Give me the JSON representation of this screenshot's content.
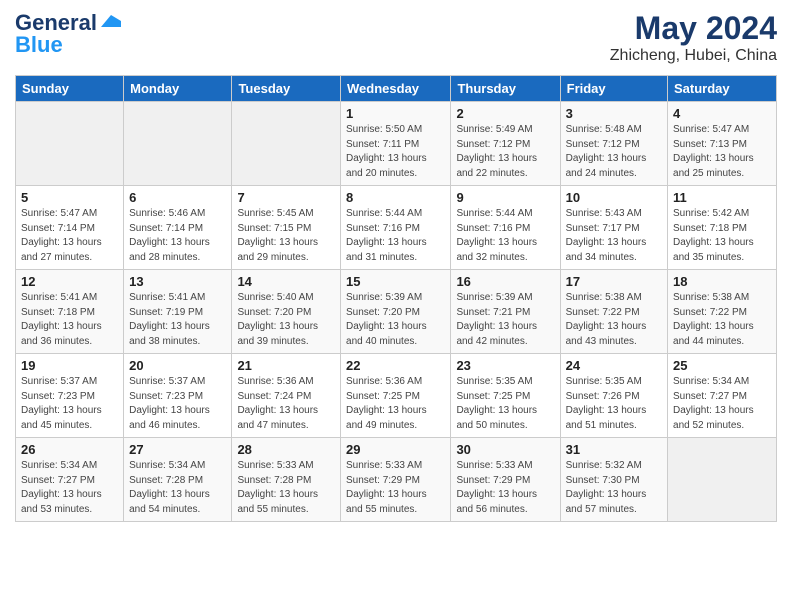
{
  "header": {
    "logo_general": "General",
    "logo_blue": "Blue",
    "month": "May 2024",
    "location": "Zhicheng, Hubei, China"
  },
  "weekdays": [
    "Sunday",
    "Monday",
    "Tuesday",
    "Wednesday",
    "Thursday",
    "Friday",
    "Saturday"
  ],
  "weeks": [
    [
      {
        "day": "",
        "sunrise": "",
        "sunset": "",
        "daylight": ""
      },
      {
        "day": "",
        "sunrise": "",
        "sunset": "",
        "daylight": ""
      },
      {
        "day": "",
        "sunrise": "",
        "sunset": "",
        "daylight": ""
      },
      {
        "day": "1",
        "sunrise": "Sunrise: 5:50 AM",
        "sunset": "Sunset: 7:11 PM",
        "daylight": "Daylight: 13 hours and 20 minutes."
      },
      {
        "day": "2",
        "sunrise": "Sunrise: 5:49 AM",
        "sunset": "Sunset: 7:12 PM",
        "daylight": "Daylight: 13 hours and 22 minutes."
      },
      {
        "day": "3",
        "sunrise": "Sunrise: 5:48 AM",
        "sunset": "Sunset: 7:12 PM",
        "daylight": "Daylight: 13 hours and 24 minutes."
      },
      {
        "day": "4",
        "sunrise": "Sunrise: 5:47 AM",
        "sunset": "Sunset: 7:13 PM",
        "daylight": "Daylight: 13 hours and 25 minutes."
      }
    ],
    [
      {
        "day": "5",
        "sunrise": "Sunrise: 5:47 AM",
        "sunset": "Sunset: 7:14 PM",
        "daylight": "Daylight: 13 hours and 27 minutes."
      },
      {
        "day": "6",
        "sunrise": "Sunrise: 5:46 AM",
        "sunset": "Sunset: 7:14 PM",
        "daylight": "Daylight: 13 hours and 28 minutes."
      },
      {
        "day": "7",
        "sunrise": "Sunrise: 5:45 AM",
        "sunset": "Sunset: 7:15 PM",
        "daylight": "Daylight: 13 hours and 29 minutes."
      },
      {
        "day": "8",
        "sunrise": "Sunrise: 5:44 AM",
        "sunset": "Sunset: 7:16 PM",
        "daylight": "Daylight: 13 hours and 31 minutes."
      },
      {
        "day": "9",
        "sunrise": "Sunrise: 5:44 AM",
        "sunset": "Sunset: 7:16 PM",
        "daylight": "Daylight: 13 hours and 32 minutes."
      },
      {
        "day": "10",
        "sunrise": "Sunrise: 5:43 AM",
        "sunset": "Sunset: 7:17 PM",
        "daylight": "Daylight: 13 hours and 34 minutes."
      },
      {
        "day": "11",
        "sunrise": "Sunrise: 5:42 AM",
        "sunset": "Sunset: 7:18 PM",
        "daylight": "Daylight: 13 hours and 35 minutes."
      }
    ],
    [
      {
        "day": "12",
        "sunrise": "Sunrise: 5:41 AM",
        "sunset": "Sunset: 7:18 PM",
        "daylight": "Daylight: 13 hours and 36 minutes."
      },
      {
        "day": "13",
        "sunrise": "Sunrise: 5:41 AM",
        "sunset": "Sunset: 7:19 PM",
        "daylight": "Daylight: 13 hours and 38 minutes."
      },
      {
        "day": "14",
        "sunrise": "Sunrise: 5:40 AM",
        "sunset": "Sunset: 7:20 PM",
        "daylight": "Daylight: 13 hours and 39 minutes."
      },
      {
        "day": "15",
        "sunrise": "Sunrise: 5:39 AM",
        "sunset": "Sunset: 7:20 PM",
        "daylight": "Daylight: 13 hours and 40 minutes."
      },
      {
        "day": "16",
        "sunrise": "Sunrise: 5:39 AM",
        "sunset": "Sunset: 7:21 PM",
        "daylight": "Daylight: 13 hours and 42 minutes."
      },
      {
        "day": "17",
        "sunrise": "Sunrise: 5:38 AM",
        "sunset": "Sunset: 7:22 PM",
        "daylight": "Daylight: 13 hours and 43 minutes."
      },
      {
        "day": "18",
        "sunrise": "Sunrise: 5:38 AM",
        "sunset": "Sunset: 7:22 PM",
        "daylight": "Daylight: 13 hours and 44 minutes."
      }
    ],
    [
      {
        "day": "19",
        "sunrise": "Sunrise: 5:37 AM",
        "sunset": "Sunset: 7:23 PM",
        "daylight": "Daylight: 13 hours and 45 minutes."
      },
      {
        "day": "20",
        "sunrise": "Sunrise: 5:37 AM",
        "sunset": "Sunset: 7:23 PM",
        "daylight": "Daylight: 13 hours and 46 minutes."
      },
      {
        "day": "21",
        "sunrise": "Sunrise: 5:36 AM",
        "sunset": "Sunset: 7:24 PM",
        "daylight": "Daylight: 13 hours and 47 minutes."
      },
      {
        "day": "22",
        "sunrise": "Sunrise: 5:36 AM",
        "sunset": "Sunset: 7:25 PM",
        "daylight": "Daylight: 13 hours and 49 minutes."
      },
      {
        "day": "23",
        "sunrise": "Sunrise: 5:35 AM",
        "sunset": "Sunset: 7:25 PM",
        "daylight": "Daylight: 13 hours and 50 minutes."
      },
      {
        "day": "24",
        "sunrise": "Sunrise: 5:35 AM",
        "sunset": "Sunset: 7:26 PM",
        "daylight": "Daylight: 13 hours and 51 minutes."
      },
      {
        "day": "25",
        "sunrise": "Sunrise: 5:34 AM",
        "sunset": "Sunset: 7:27 PM",
        "daylight": "Daylight: 13 hours and 52 minutes."
      }
    ],
    [
      {
        "day": "26",
        "sunrise": "Sunrise: 5:34 AM",
        "sunset": "Sunset: 7:27 PM",
        "daylight": "Daylight: 13 hours and 53 minutes."
      },
      {
        "day": "27",
        "sunrise": "Sunrise: 5:34 AM",
        "sunset": "Sunset: 7:28 PM",
        "daylight": "Daylight: 13 hours and 54 minutes."
      },
      {
        "day": "28",
        "sunrise": "Sunrise: 5:33 AM",
        "sunset": "Sunset: 7:28 PM",
        "daylight": "Daylight: 13 hours and 55 minutes."
      },
      {
        "day": "29",
        "sunrise": "Sunrise: 5:33 AM",
        "sunset": "Sunset: 7:29 PM",
        "daylight": "Daylight: 13 hours and 55 minutes."
      },
      {
        "day": "30",
        "sunrise": "Sunrise: 5:33 AM",
        "sunset": "Sunset: 7:29 PM",
        "daylight": "Daylight: 13 hours and 56 minutes."
      },
      {
        "day": "31",
        "sunrise": "Sunrise: 5:32 AM",
        "sunset": "Sunset: 7:30 PM",
        "daylight": "Daylight: 13 hours and 57 minutes."
      },
      {
        "day": "",
        "sunrise": "",
        "sunset": "",
        "daylight": ""
      }
    ]
  ]
}
